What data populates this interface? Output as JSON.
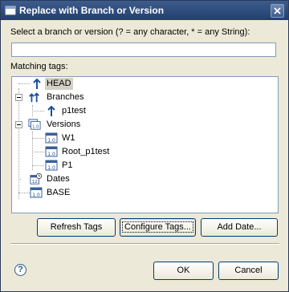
{
  "window": {
    "title": "Replace with Branch or Version"
  },
  "filter": {
    "label": "Select a branch or version (? = any character, * = any String):",
    "value": ""
  },
  "tags": {
    "label": "Matching tags:",
    "nodes": {
      "head": "HEAD",
      "branches": "Branches",
      "p1test": "p1test",
      "versions": "Versions",
      "w1": "W1",
      "root_p1test": "Root_p1test",
      "p1": "P1",
      "dates": "Dates",
      "base": "BASE"
    }
  },
  "buttons": {
    "refresh": "Refresh Tags",
    "configure": "Configure Tags...",
    "add_date": "Add Date...",
    "ok": "OK",
    "cancel": "Cancel"
  },
  "icons": {
    "help": "?",
    "version_badge": "1.0",
    "date_badge": "12"
  }
}
